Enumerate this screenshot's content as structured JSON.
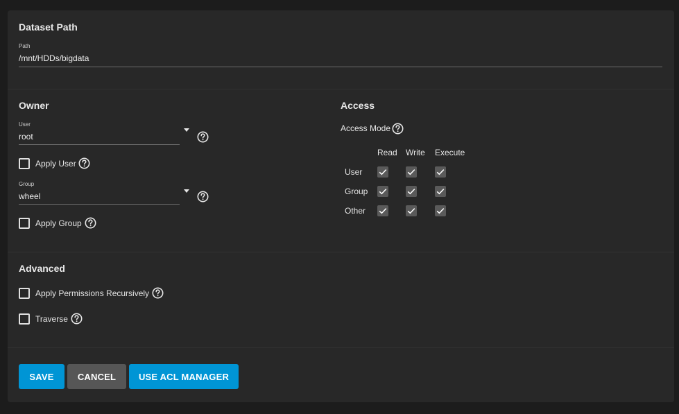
{
  "dataset": {
    "title": "Dataset Path",
    "path_label": "Path",
    "path_value": "/mnt/HDDs/bigdata"
  },
  "owner": {
    "title": "Owner",
    "user_label": "User",
    "user_value": "root",
    "apply_user_label": "Apply User",
    "group_label": "Group",
    "group_value": "wheel",
    "apply_group_label": "Apply Group"
  },
  "access": {
    "title": "Access",
    "mode_label": "Access Mode",
    "columns": [
      "Read",
      "Write",
      "Execute"
    ],
    "rows": [
      {
        "label": "User",
        "read": true,
        "write": true,
        "execute": true
      },
      {
        "label": "Group",
        "read": true,
        "write": true,
        "execute": true
      },
      {
        "label": "Other",
        "read": true,
        "write": true,
        "execute": true
      }
    ]
  },
  "advanced": {
    "title": "Advanced",
    "recursive_label": "Apply Permissions Recursively",
    "traverse_label": "Traverse"
  },
  "buttons": {
    "save": "SAVE",
    "cancel": "CANCEL",
    "acl": "USE ACL MANAGER"
  },
  "colors": {
    "primary": "#0095d5",
    "secondary": "#565656",
    "card_bg": "#282828",
    "page_bg": "#1c1c1c"
  }
}
